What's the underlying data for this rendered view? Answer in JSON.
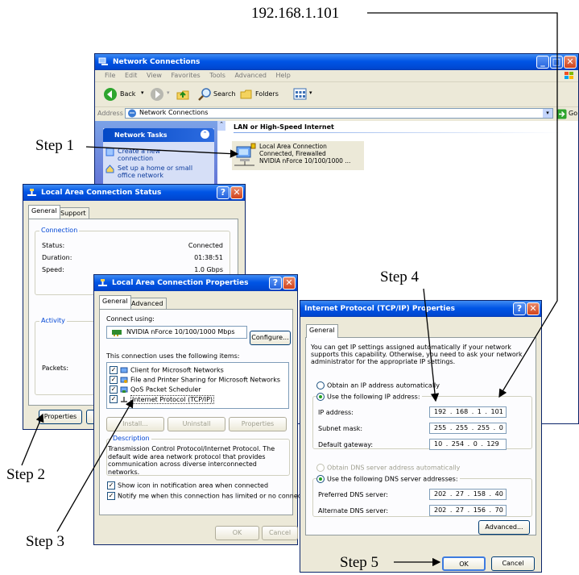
{
  "annotations": {
    "ip_callout": "192.168.1.101",
    "step1": "Step 1",
    "step2": "Step 2",
    "step3": "Step 3",
    "step4": "Step 4",
    "step5": "Step 5"
  },
  "network_connections": {
    "title": "Network Connections",
    "menu": [
      "File",
      "Edit",
      "View",
      "Favorites",
      "Tools",
      "Advanced",
      "Help"
    ],
    "back_label": "Back",
    "search_label": "Search",
    "folders_label": "Folders",
    "address_label": "Address",
    "address_value": "Network Connections",
    "go_label": "Go",
    "tasks_header": "Network Tasks",
    "tasks": [
      "Create a new connection",
      "Set up a home or small office network"
    ],
    "section_header": "LAN or High-Speed Internet",
    "item_name": "Local Area Connection",
    "item_status": "Connected, Firewalled",
    "item_device": "NVIDIA nForce 10/100/1000 ..."
  },
  "status_dialog": {
    "title": "Local Area Connection Status",
    "tabs": [
      "General",
      "Support"
    ],
    "connection_group": "Connection",
    "rows": [
      {
        "label": "Status:",
        "value": "Connected"
      },
      {
        "label": "Duration:",
        "value": "01:38:51"
      },
      {
        "label": "Speed:",
        "value": "1.0 Gbps"
      }
    ],
    "activity_group": "Activity",
    "packets_label": "Packets:",
    "properties_button": "Properties"
  },
  "properties_dialog": {
    "title": "Local Area Connection Properties",
    "tabs": [
      "General",
      "Advanced"
    ],
    "connect_using": "Connect using:",
    "adapter": "NVIDIA nForce 10/100/1000 Mbps",
    "configure_button": "Configure...",
    "items_label": "This connection uses the following items:",
    "items": [
      "Client for Microsoft Networks",
      "File and Printer Sharing for Microsoft Networks",
      "QoS Packet Scheduler",
      "Internet Protocol (TCP/IP)"
    ],
    "install_button": "Install...",
    "uninstall_button": "Uninstall",
    "properties_button": "Properties",
    "description_group": "Description",
    "description": "Transmission Control Protocol/Internet Protocol. The default wide area network protocol that provides communication across diverse interconnected networks.",
    "show_icon": "Show icon in notification area when connected",
    "notify": "Notify me when this connection has limited or no connectivity",
    "ok_button": "OK",
    "cancel_button": "Cancel"
  },
  "tcpip_dialog": {
    "title": "Internet Protocol (TCP/IP) Properties",
    "tab": "General",
    "intro": "You can get IP settings assigned automatically if your network supports this capability. Otherwise, you need to ask your network administrator for the appropriate IP settings.",
    "auto_ip": "Obtain an IP address automatically",
    "use_ip": "Use the following IP address:",
    "ip_label": "IP address:",
    "ip_value": "192 . 168 .  1  . 101",
    "mask_label": "Subnet mask:",
    "mask_value": "255 . 255 . 255 .  0",
    "gateway_label": "Default gateway:",
    "gateway_value": "10 . 254 .  0  . 129",
    "auto_dns": "Obtain DNS server address automatically",
    "use_dns": "Use the following DNS server addresses:",
    "pref_dns_label": "Preferred DNS server:",
    "pref_dns_value": "202 . 27 . 158 . 40",
    "alt_dns_label": "Alternate DNS server:",
    "alt_dns_value": "202 . 27 . 156 . 70",
    "advanced_button": "Advanced...",
    "ok_button": "OK",
    "cancel_button": "Cancel"
  }
}
